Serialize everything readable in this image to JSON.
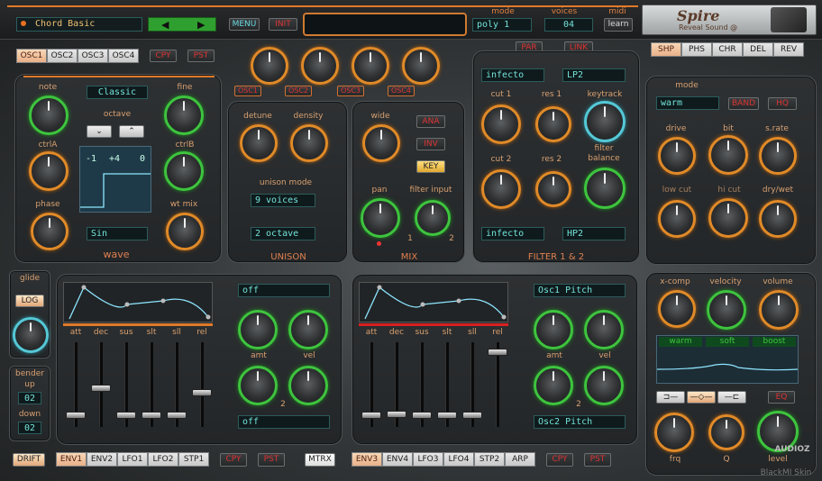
{
  "header": {
    "preset_name": "Chord Basic",
    "menu_label": "MENU",
    "init_label": "INIT",
    "mode_label": "mode",
    "mode_value": "poly 1",
    "voices_label": "voices",
    "voices_value": "04",
    "midi_label": "midi",
    "learn_label": "learn",
    "logo_text": "Spire",
    "logo_sub": "Reveal Sound @"
  },
  "osc": {
    "tabs": [
      "OSC1",
      "OSC2",
      "OSC3",
      "OSC4"
    ],
    "copy_label": "CPY",
    "paste_label": "PST",
    "mini_knobs": [
      "OSC1",
      "OSC2",
      "OSC3",
      "OSC4"
    ],
    "note_label": "note",
    "fine_label": "fine",
    "wave_type": "Classic",
    "octave_label": "octave",
    "ctrlA_label": "ctrlA",
    "ctrlB_label": "ctrlB",
    "phase_label": "phase",
    "wtmix_label": "wt mix",
    "readout_values": [
      "-1",
      "+4",
      "0"
    ],
    "wave_shape": "Sin",
    "section_title": "wave"
  },
  "unison": {
    "detune_label": "detune",
    "density_label": "density",
    "mode_label": "unison mode",
    "voices_value": "9 voices",
    "octave_value": "2 octave",
    "section_title": "UNISON"
  },
  "mix": {
    "wide_label": "wide",
    "ana_label": "ANA",
    "inv_label": "INV",
    "key_label": "KEY",
    "pan_label": "pan",
    "filter_input_label": "filter input",
    "in1": "1",
    "in2": "2",
    "section_title": "MIX"
  },
  "filter": {
    "par_label": "PAR",
    "link_label": "LINK",
    "type1": "infecto",
    "mode1": "LP2",
    "cut1_label": "cut 1",
    "res1_label": "res 1",
    "keytrack_label": "keytrack",
    "cut2_label": "cut 2",
    "res2_label": "res 2",
    "balance_label": "filter balance",
    "type2": "infecto",
    "mode2": "HP2",
    "section_title": "FILTER 1 & 2"
  },
  "fx": {
    "tabs": [
      "SHP",
      "PHS",
      "CHR",
      "DEL",
      "REV"
    ],
    "mode_label": "mode",
    "mode_value": "warm",
    "band_label": "BAND",
    "hq_label": "HQ",
    "drive_label": "drive",
    "bit_label": "bit",
    "srate_label": "s.rate",
    "lowcut_label": "low cut",
    "hicut_label": "hi cut",
    "drywet_label": "dry/wet"
  },
  "glide": {
    "glide_label": "glide",
    "log_label": "LOG",
    "bender_label": "bender",
    "up_label": "up",
    "up_value": "02",
    "down_label": "down",
    "down_value": "02"
  },
  "env1": {
    "dest": "off",
    "dest2": "off",
    "labels": [
      "att",
      "dec",
      "sus",
      "slt",
      "sll",
      "rel"
    ],
    "slider_levels": [
      0.1,
      0.45,
      0.1,
      0.1,
      0.1,
      0.4
    ],
    "amt_label": "amt",
    "vel_label": "vel",
    "num_label": "2"
  },
  "env2": {
    "dest": "Osc1 Pitch",
    "dest2": "Osc2 Pitch",
    "labels": [
      "att",
      "dec",
      "sus",
      "slt",
      "sll",
      "rel"
    ],
    "slider_levels": [
      0.1,
      0.12,
      0.1,
      0.1,
      0.1,
      0.92
    ],
    "amt_label": "amt",
    "vel_label": "vel",
    "num_label": "2"
  },
  "eq": {
    "xcomp_label": "x-comp",
    "velocity_label": "velocity",
    "volume_label": "volume",
    "mode_warm": "warm",
    "mode_soft": "soft",
    "mode_boost": "boost",
    "eq_label": "EQ",
    "frq_label": "frq",
    "q_label": "Q",
    "level_label": "level"
  },
  "footer": {
    "drift_label": "DRIFT",
    "mod_tabs_left": [
      "ENV1",
      "ENV2",
      "LFO1",
      "LFO2",
      "STP1"
    ],
    "copy_label": "CPY",
    "paste_label": "PST",
    "mtrx_label": "MTRX",
    "mod_tabs_right": [
      "ENV3",
      "ENV4",
      "LFO3",
      "LFO4",
      "STP2",
      "ARP"
    ],
    "copy2_label": "CPY",
    "paste2_label": "PST",
    "skin_label": "BlackMI Skin",
    "watermark": "AUDIOZ"
  }
}
